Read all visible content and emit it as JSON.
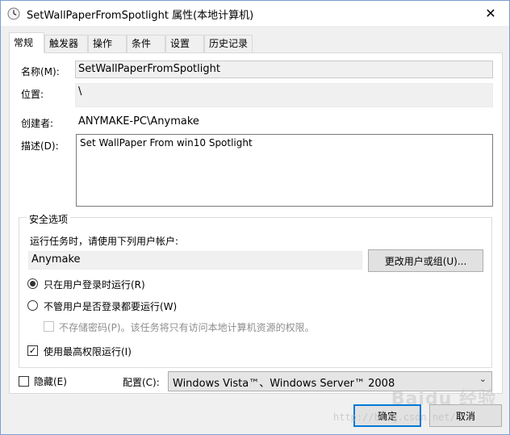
{
  "window": {
    "title": "SetWallPaperFromSpotlight 属性(本地计算机)",
    "close_glyph": "✕"
  },
  "tabs": [
    {
      "label": "常规"
    },
    {
      "label": "触发器"
    },
    {
      "label": "操作"
    },
    {
      "label": "条件"
    },
    {
      "label": "设置"
    },
    {
      "label": "历史记录"
    }
  ],
  "general": {
    "name_label": "名称(M):",
    "name_value": "SetWallPaperFromSpotlight",
    "location_label": "位置:",
    "location_value": "\\",
    "author_label": "创建者:",
    "author_value": "ANYMAKE-PC\\Anymake",
    "description_label": "描述(D):",
    "description_value": "Set WallPaper From win10 Spotlight"
  },
  "security": {
    "legend": "安全选项",
    "run_as_prompt": "运行任务时，请使用下列用户帐户:",
    "user_account": "Anymake",
    "change_user_button": "更改用户或组(U)...",
    "radio_logged_on": "只在用户登录时运行(R)",
    "radio_logged_on_checked": true,
    "radio_whether_logged": "不管用户是否登录都要运行(W)",
    "radio_whether_logged_checked": false,
    "no_store_password": "不存储密码(P)。该任务将只有访问本地计算机资源的权限。",
    "no_store_password_checked": false,
    "highest_privileges": "使用最高权限运行(I)",
    "highest_privileges_checked": true
  },
  "footer": {
    "hidden_label": "隐藏(E)",
    "hidden_checked": false,
    "configure_label": "配置(C):",
    "configure_value": "Windows Vista™、Windows Server™ 2008",
    "ok_button": "确定",
    "cancel_button": "取消"
  },
  "watermark": {
    "logo": "Baidu 经验",
    "url": "http://blog.csdn.net/"
  },
  "colors": {
    "accent": "#0078d7",
    "window_bg": "#f0f0f0",
    "panel_bg": "#ffffff"
  }
}
